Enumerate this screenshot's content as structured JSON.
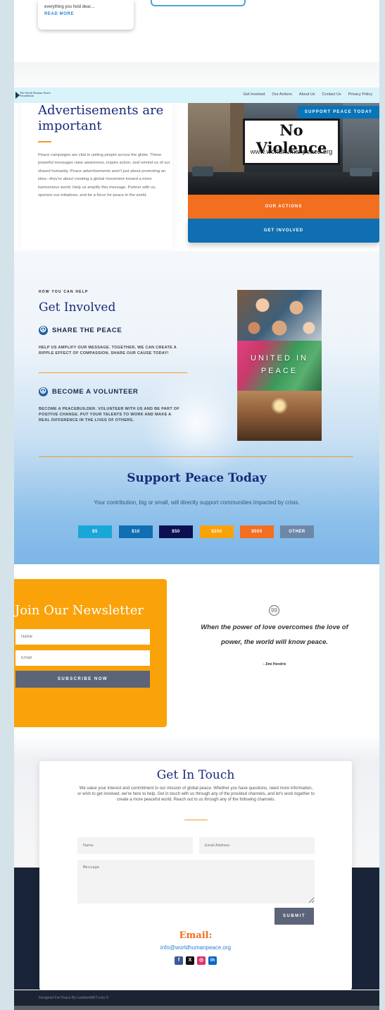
{
  "blog_card": {
    "excerpt_tail": "everything you hold dear,...",
    "read_more": "READ MORE"
  },
  "nav": {
    "logo_text": "The World Human Peace Foundation",
    "links": [
      "Get Involved",
      "Our Actions",
      "About Us",
      "Contact Us",
      "Privacy Policy"
    ]
  },
  "ads": {
    "title": "Advertisements are important",
    "body": "Peace campaigns are vital in uniting people across the globe. These powerful messages raise awareness, inspire action, and remind us of our shared humanity. Peace advertisements aren't just about promoting an idea—they're about creating a global movement toward a more harmonious world. Help us amplify this message. Partner with us, sponsor our initiatives, and be a force for peace in the world.",
    "billboard_title": "No Violence",
    "billboard_url": "www.worldhumanpeace.org",
    "support_tag": "SUPPORT PEACE TODAY",
    "our_actions": "OUR ACTIONS",
    "get_involved": "GET INVOLVED"
  },
  "involved": {
    "kicker": "HOW YOU CAN HELP",
    "title": "Get Involved",
    "feature1_title": "SHARE THE PEACE",
    "feature1_body": "HELP US AMPLIFY OUR MESSAGE. TOGETHER, WE CAN CREATE A RIPPLE EFFECT OF COMPASSION. SHARE OUR CAUSE TODAY!",
    "feature2_title": "BECOME A VOLUNTEER",
    "feature2_body": "BECOME A PEACEBUILDER. VOLUNTEER WITH US AND BE PART OF POSITIVE CHANGE. PUT YOUR TALENTS TO WORK AND MAKE A REAL DIFFERENCE IN THE LIVES OF OTHERS.",
    "photo_text": "UNITED IN PEACE"
  },
  "support": {
    "title": "Support Peace Today",
    "subtitle": "Your contribution, big or small, will directly support communities impacted by crisis.",
    "amounts": [
      {
        "label": "$5",
        "color": "#1aa6d6"
      },
      {
        "label": "$10",
        "color": "#0f6fb2"
      },
      {
        "label": "$50",
        "color": "#0c0f52"
      },
      {
        "label": "$250",
        "color": "#f9a20a"
      },
      {
        "label": "$500",
        "color": "#f26f1f"
      },
      {
        "label": "OTHER",
        "color": "#6e87a8"
      }
    ]
  },
  "newsletter": {
    "title": "Join Our Newsletter",
    "name_placeholder": "Name",
    "email_placeholder": "Email",
    "subscribe": "SUBSCRIBE NOW",
    "quote": "When the power of love overcomes the love of power, the world will know peace.",
    "quote_author": "- Jimi Hendrix"
  },
  "contact": {
    "title": "Get In Touch",
    "body": "We value your interest and commitment to our mission of global peace. Whether you have questions, need more information, or wish to get involved, we're here to help. Get in touch with us through any of the provided channels, and let's work together to create a more peaceful world. Reach out to us through any of the following channels.",
    "name_placeholder": "Name",
    "email_placeholder": "Email Address",
    "message_placeholder": "Message",
    "submit": "SUBMIT",
    "email_label": "Email:",
    "email_value": "info@worldhumanpeace.org",
    "socials": [
      {
        "icon": "facebook-icon",
        "glyph": "f",
        "color": "#3b5998"
      },
      {
        "icon": "x-icon",
        "glyph": "X",
        "color": "#111111"
      },
      {
        "icon": "instagram-icon",
        "glyph": "◎",
        "color": "#e1306c"
      },
      {
        "icon": "linkedin-icon",
        "glyph": "in",
        "color": "#0a66c2"
      }
    ]
  },
  "footer": {
    "text": "Designed For Peace By LastdemMKT.com ©"
  }
}
